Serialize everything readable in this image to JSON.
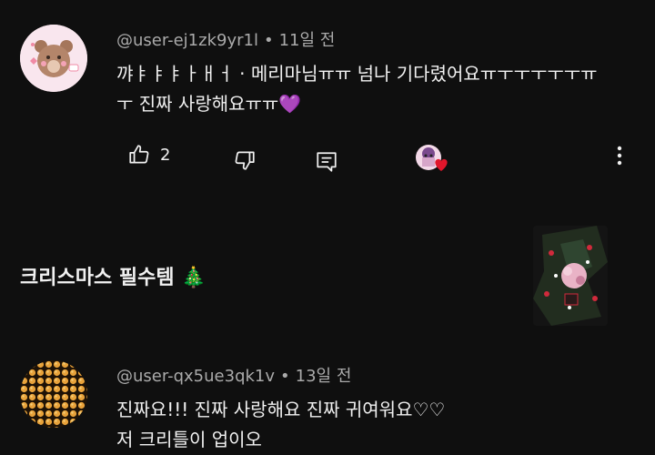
{
  "comments": [
    {
      "author": "@user-ej1zk9yr1l",
      "time": "11일 전",
      "text_line1": "꺄ㅑㅑㅑㅏㅐㅓ · 메리마님ㅠㅠ 넘나 기다렸어요ㅠㅜㅜㅜㅜㅜㅠ",
      "text_line2": "ㅜ 진짜 사랑해요ㅠㅠ💜",
      "likes": "2"
    },
    {
      "author": "@user-qx5ue3qk1v",
      "time": "13일 전",
      "text_line1": "진짜요!!!  진짜 사랑해요 진짜 귀여워요♡♡",
      "text_line2": "저 크리틀이 업이오"
    }
  ],
  "section": {
    "title": "크리스마스 필수템 🎄"
  },
  "icons": {
    "like": "thumbs-up-icon",
    "dislike": "thumbs-down-icon",
    "reply": "reply-icon",
    "more": "more-vert-icon",
    "heart": "creator-heart-icon"
  },
  "colors": {
    "background": "#0f0f0f",
    "text": "#f1f1f1",
    "meta": "#aaaaaa",
    "heart": "#e0162b"
  }
}
